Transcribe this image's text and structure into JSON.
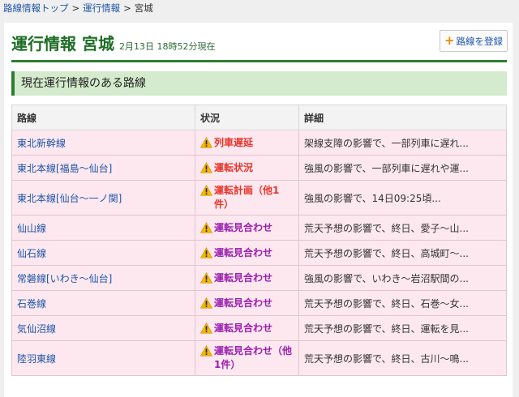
{
  "breadcrumb": {
    "items": [
      "路線情報トップ",
      "運行情報"
    ],
    "separator": ">",
    "current": "宮城"
  },
  "header": {
    "title": "運行情報 宮城",
    "subtitle": "2月13日 18時52分現在",
    "register_button": "路線を登録"
  },
  "section": {
    "title": "現在運行情報のある路線"
  },
  "table": {
    "columns": [
      "路線",
      "状況",
      "詳細"
    ],
    "rows": [
      {
        "line": "東北新幹線",
        "status": "列車遅延",
        "kind": "delay",
        "detail": "架線支障の影響で、一部列車に遅れ..."
      },
      {
        "line": "東北本線[福島～仙台]",
        "status": "運転状況",
        "kind": "info",
        "detail": "強風の影響で、一部列車に遅れや運..."
      },
      {
        "line": "東北本線[仙台～一ノ関]",
        "status": "運転計画（他1件）",
        "kind": "plan",
        "detail": "強風の影響で、14日09:25頃..."
      },
      {
        "line": "仙山線",
        "status": "運転見合わせ",
        "kind": "suspend",
        "detail": "荒天予想の影響で、終日、愛子～山..."
      },
      {
        "line": "仙石線",
        "status": "運転見合わせ",
        "kind": "suspend",
        "detail": "荒天予想の影響で、終日、高城町～..."
      },
      {
        "line": "常磐線[いわき～仙台]",
        "status": "運転見合わせ",
        "kind": "suspend",
        "detail": "強風の影響で、いわき～岩沼駅間の..."
      },
      {
        "line": "石巻線",
        "status": "運転見合わせ",
        "kind": "suspend",
        "detail": "荒天予想の影響で、終日、石巻～女..."
      },
      {
        "line": "気仙沼線",
        "status": "運転見合わせ",
        "kind": "suspend",
        "detail": "荒天予想の影響で、終日、運転を見..."
      },
      {
        "line": "陸羽東線",
        "status": "運転見合わせ（他1件）",
        "kind": "suspend",
        "detail": "荒天予想の影響で、終日、古川～鳴..."
      }
    ]
  },
  "icons": {
    "warning": "warning-triangle-icon",
    "register": "plus-icon"
  },
  "colors": {
    "title_green": "#1e6e25",
    "row_pink": "#fde8ef",
    "link_blue": "#1d55a8",
    "status_red": "#e8352b",
    "status_purple": "#9b1fb0"
  }
}
